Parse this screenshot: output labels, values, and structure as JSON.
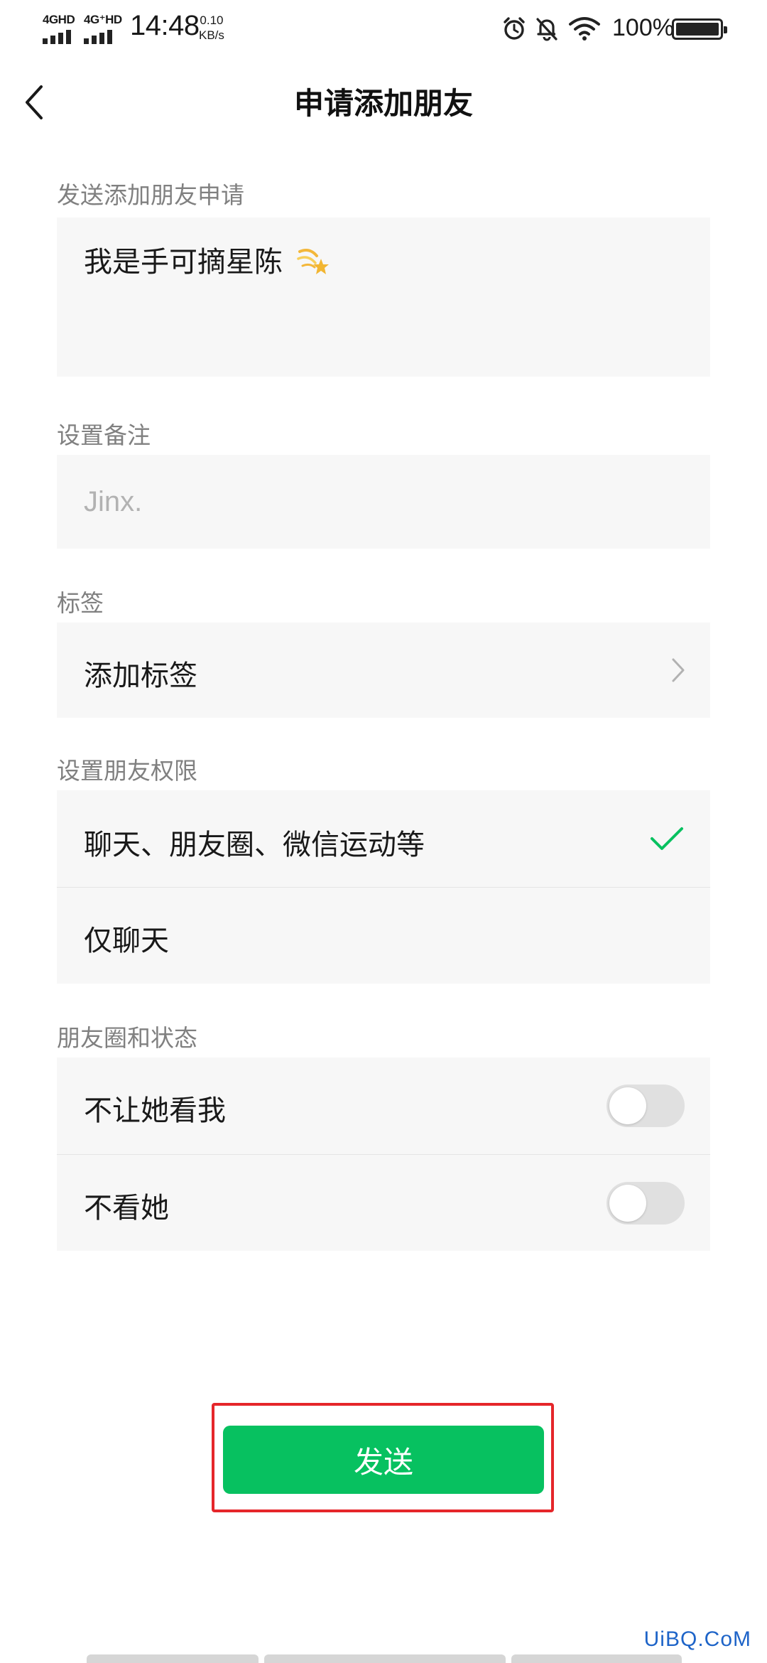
{
  "status_bar": {
    "network_1": "4GHD",
    "network_2": "4G⁺HD",
    "time": "14:48",
    "speed_value": "0.10",
    "speed_unit": "KB/s",
    "battery_percent": "100%",
    "icons": [
      "signal-icon",
      "alarm-icon",
      "mute-bell-icon",
      "wifi-icon",
      "battery-icon"
    ]
  },
  "header": {
    "back_icon": "chevron-left-icon",
    "title": "申请添加朋友"
  },
  "request_section": {
    "label": "发送添加朋友申请",
    "message": "我是手可摘星陈",
    "emoji": "shooting-star-emoji"
  },
  "remark_section": {
    "label": "设置备注",
    "placeholder": "Jinx."
  },
  "tag_section": {
    "label": "标签",
    "add_tag": "添加标签",
    "icon": "chevron-right-icon"
  },
  "permission_section": {
    "label": "设置朋友权限",
    "options": [
      {
        "label": "聊天、朋友圈、微信运动等",
        "selected": true
      },
      {
        "label": "仅聊天",
        "selected": false
      }
    ],
    "selected_color": "#07c160"
  },
  "moments_section": {
    "label": "朋友圈和状态",
    "toggles": [
      {
        "label": "不让她看我",
        "on": false
      },
      {
        "label": "不看她",
        "on": false
      }
    ]
  },
  "send_button": {
    "label": "发送",
    "color": "#07c160",
    "highlight_color": "#e5262a"
  },
  "watermark": "UiBQ.CoM"
}
